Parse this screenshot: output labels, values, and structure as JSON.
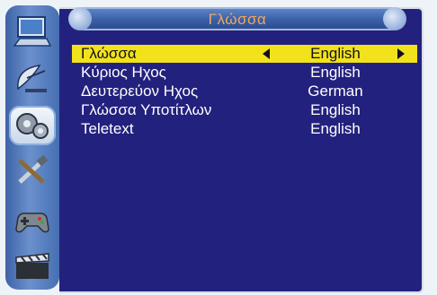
{
  "title": "Γλώσσα",
  "sidebar": {
    "icons": [
      {
        "name": "computer-icon"
      },
      {
        "name": "satellite-dish-icon"
      },
      {
        "name": "settings-gears-icon"
      },
      {
        "name": "tools-icon"
      },
      {
        "name": "gamepad-icon"
      },
      {
        "name": "clapperboard-icon"
      }
    ],
    "active_index": 2
  },
  "settings": [
    {
      "label": "Γλώσσα",
      "value": "English"
    },
    {
      "label": "Κύριος Ηχος",
      "value": "English"
    },
    {
      "label": "Δευτερεύον Ηχος",
      "value": "German"
    },
    {
      "label": "Γλώσσα Υποτίτλων",
      "value": "English"
    },
    {
      "label": "Teletext",
      "value": "English"
    }
  ],
  "colors": {
    "panel": "#23217e",
    "highlight": "#f2e21c",
    "title_text": "#f0a860"
  }
}
